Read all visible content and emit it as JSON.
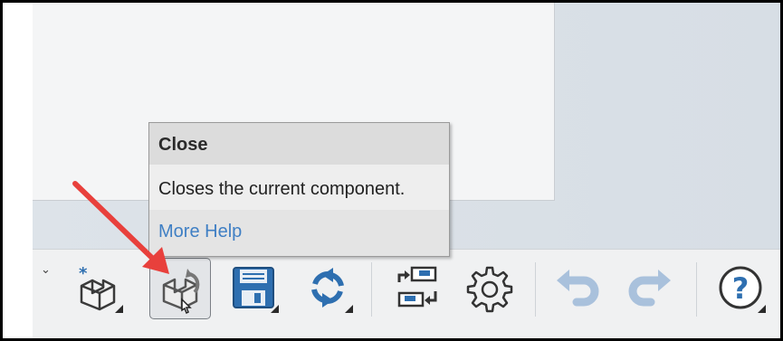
{
  "tooltip": {
    "title": "Close",
    "description": "Closes the current component.",
    "help_link": "More Help"
  },
  "toolbar": {
    "buttons": [
      {
        "name": "new-component",
        "icon": "new-component-icon"
      },
      {
        "name": "close",
        "icon": "close-component-icon",
        "state": "hovered"
      },
      {
        "name": "save",
        "icon": "save-icon"
      },
      {
        "name": "refresh",
        "icon": "refresh-icon"
      },
      {
        "name": "replace",
        "icon": "replace-icon"
      },
      {
        "name": "settings",
        "icon": "gear-icon"
      },
      {
        "name": "undo",
        "icon": "undo-icon"
      },
      {
        "name": "redo",
        "icon": "redo-icon"
      },
      {
        "name": "help",
        "icon": "help-icon",
        "glyph": "?"
      }
    ]
  },
  "colors": {
    "accent_blue": "#2e6fb0",
    "link": "#3f7fc4",
    "annotation_arrow": "#e8403c"
  }
}
